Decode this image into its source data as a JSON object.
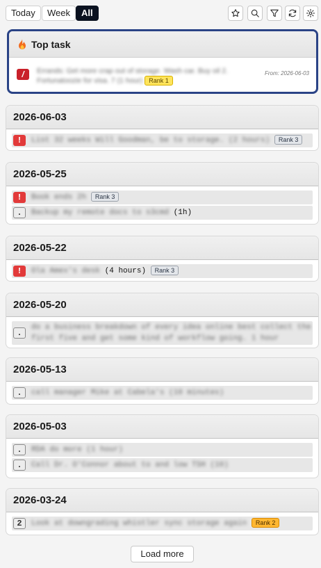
{
  "tabs": [
    {
      "label": "Today",
      "active": false
    },
    {
      "label": "Week",
      "active": false
    },
    {
      "label": "All",
      "active": true
    }
  ],
  "tools": [
    "star-icon",
    "search-icon",
    "filter-icon",
    "refresh-icon",
    "gear-icon"
  ],
  "top_task": {
    "title": "Top task",
    "priority": "/",
    "text": "Errands: Get more crap out of storage. Wash car. Buy oil 2. Fortunatoozie for visa. 7 (1 hour)",
    "rank": "Rank 1",
    "from": "From: 2026-06-03"
  },
  "days": [
    {
      "date": "2026-06-03",
      "tasks": [
        {
          "priority": "!",
          "text": "List 32 weeks Will Goodman, be to storage. (2 hours)",
          "extra": "",
          "rank": "Rank 3"
        }
      ]
    },
    {
      "date": "2026-05-25",
      "tasks": [
        {
          "priority": "!",
          "text": "Book ends 2h",
          "extra": "",
          "rank": "Rank 3"
        },
        {
          "priority": ".",
          "text": "Backup my remote docs to s3cmd",
          "extra": "(1h)",
          "rank": ""
        }
      ]
    },
    {
      "date": "2026-05-22",
      "tasks": [
        {
          "priority": "!",
          "text": "Ola Amex's desk",
          "extra": "(4 hours)",
          "rank": "Rank 3"
        }
      ]
    },
    {
      "date": "2026-05-20",
      "tasks": [
        {
          "priority": ".",
          "text": "do a business breakdown of every idea online best collect the first five and get some kind of workflow going. 1 hour",
          "extra": "",
          "rank": ""
        }
      ]
    },
    {
      "date": "2026-05-13",
      "tasks": [
        {
          "priority": ".",
          "text": "call manager Mike at Cabela's (10 minutes)",
          "extra": "",
          "rank": ""
        }
      ]
    },
    {
      "date": "2026-05-03",
      "tasks": [
        {
          "priority": ".",
          "text": "RDA do more (1 hour)",
          "extra": "",
          "rank": ""
        },
        {
          "priority": ".",
          "text": "Call Dr. O'Connor about to and low TSH (10)",
          "extra": "",
          "rank": ""
        }
      ]
    },
    {
      "date": "2026-03-24",
      "tasks": [
        {
          "priority": "2",
          "text": "Look at downgrading whistler sync storage again",
          "extra": "",
          "rank": "Rank 2"
        }
      ]
    }
  ],
  "load_more": "Load more",
  "colors": {
    "accent_border": "#2a4386",
    "priority_red": "#e23a3a",
    "rank1": "#ffe45c",
    "rank2": "#ffb732"
  }
}
